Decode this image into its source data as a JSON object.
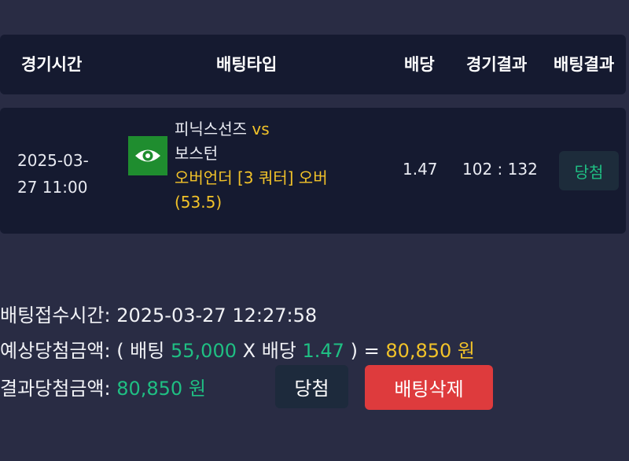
{
  "header": {
    "col_time": "경기시간",
    "col_bet_type": "배팅타입",
    "col_odds": "배당",
    "col_game_result": "경기결과",
    "col_bet_result": "배팅결과"
  },
  "row": {
    "time_line1": "2025-03-",
    "time_line2": "27 11:00",
    "icon": "eye-icon",
    "team_home": "피닉스선즈",
    "vs": "vs",
    "team_away": "보스턴",
    "bet_desc": "오버언더 [3 쿼터] 오버",
    "bet_line": "(53.5)",
    "odds": "1.47",
    "score": "102 : 132",
    "result": "당첨"
  },
  "summary": {
    "accept_label": "배팅접수시간:",
    "accept_time": "2025-03-27 12:27:58",
    "expected_label": "예상당첨금액: ( 배팅",
    "bet_amount": "55,000",
    "x_label": "X 배당",
    "odds": "1.47",
    "eq_label": ") =",
    "expected_amount": "80,850 원",
    "result_label": "결과당첨금액:",
    "result_amount": "80,850 원"
  },
  "buttons": {
    "win_label": "당첨",
    "delete_label": "배팅삭제"
  },
  "colors": {
    "background": "#292c44",
    "card": "#151a30",
    "accent_yellow": "#f2c329",
    "accent_green": "#1fbf83",
    "delete_red": "#de3b3d"
  }
}
